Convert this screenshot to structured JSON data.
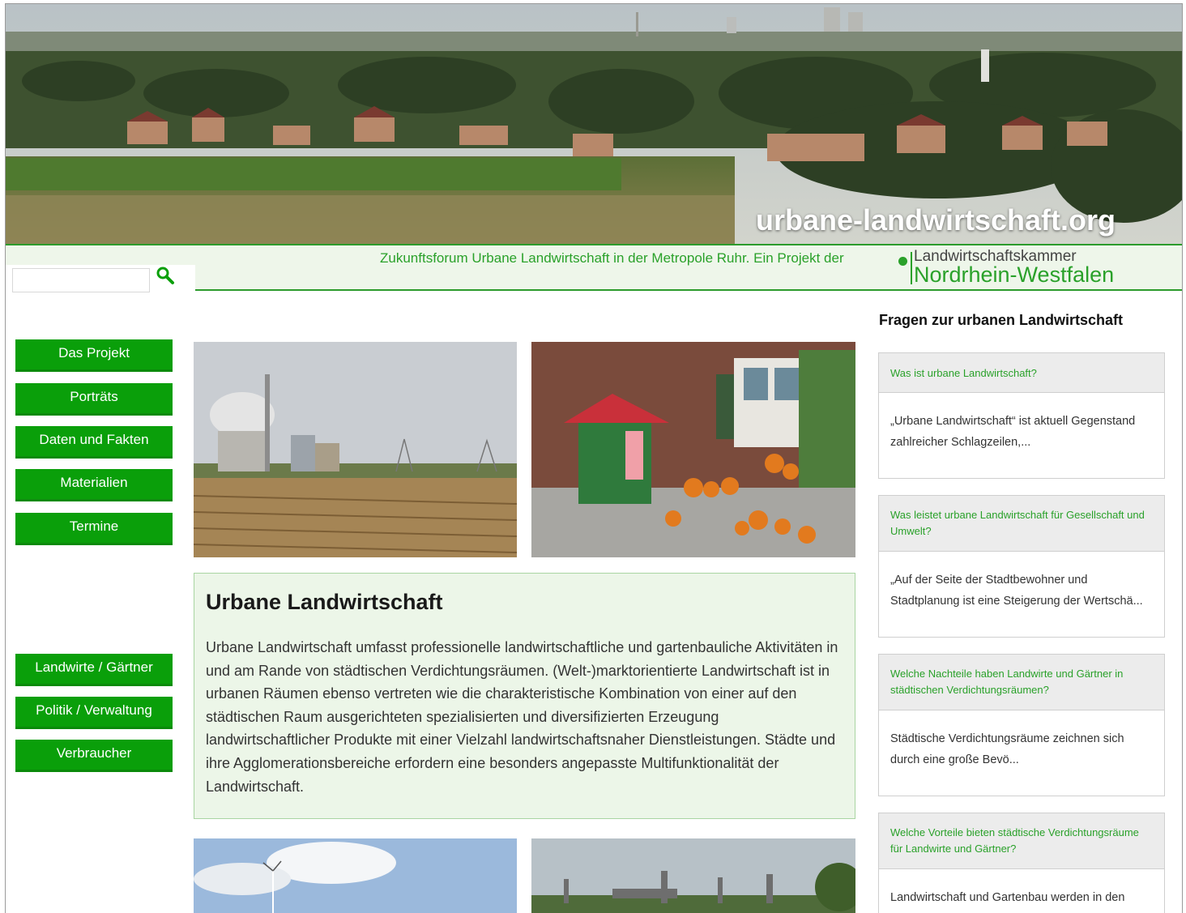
{
  "site": {
    "title": "urbane-landwirtschaft.org",
    "tagline": "Zukunftsforum Urbane Landwirtschaft in der Metropole Ruhr. Ein Projekt der",
    "partner_logo_top": "Landwirtschaftskammer",
    "partner_logo_bottom": "Nordrhein-Westfalen"
  },
  "search": {
    "placeholder": "",
    "value": ""
  },
  "nav": {
    "primary": [
      "Das Projekt",
      "Porträts",
      "Daten und Fakten",
      "Materialien",
      "Termine"
    ],
    "audience": [
      "Landwirte / Gärtner",
      "Politik / Verwaltung",
      "Verbraucher"
    ]
  },
  "intro": {
    "title": "Urbane Landwirtschaft",
    "text": "Urbane Landwirtschaft umfasst professionelle landwirtschaftliche und gartenbauliche Aktivitäten in und am Rande von städtischen Verdichtungsräumen. (Welt-)marktorientierte Landwirtschaft ist in urbanen Räumen ebenso vertreten wie die charakteristische Kombination von einer auf den städtischen Raum ausgerichteten spezialisierten und diversifizierten Erzeugung landwirtschaftlicher Produkte mit einer Vielzahl landwirtschaftsnaher Dienstleistungen. Städte und ihre Agglomerationsbereiche erfordern eine besonders angepasste Multifunktionalität der Landwirtschaft."
  },
  "faq": {
    "heading": "Fragen zur urbanen Landwirtschaft",
    "items": [
      {
        "q": "Was ist urbane Landwirtschaft?",
        "a": "„Urbane Landwirtschaft“ ist aktuell Gegenstand zahlreicher Schlagzeilen,..."
      },
      {
        "q": "Was leistet urbane Landwirtschaft für Gesellschaft und Umwelt?",
        "a": "„Auf der Seite der Stadtbewohner und Stadtplanung ist eine Steigerung der Wertschä..."
      },
      {
        "q": "Welche Nachteile haben Landwirte und Gärtner in städtischen Verdichtungsräumen?",
        "a": "Städtische Verdichtungsräume zeichnen sich durch eine große Bevö..."
      },
      {
        "q": "Welche Vorteile bieten städtische Verdichtungsräume für Landwirte und Gärtner?",
        "a": "Landwirtschaft und Gartenbau werden in den"
      }
    ]
  },
  "colors": {
    "accent_green": "#0a9f0a",
    "text_green": "#2aa12a",
    "intro_bg": "#ecf6e8"
  }
}
